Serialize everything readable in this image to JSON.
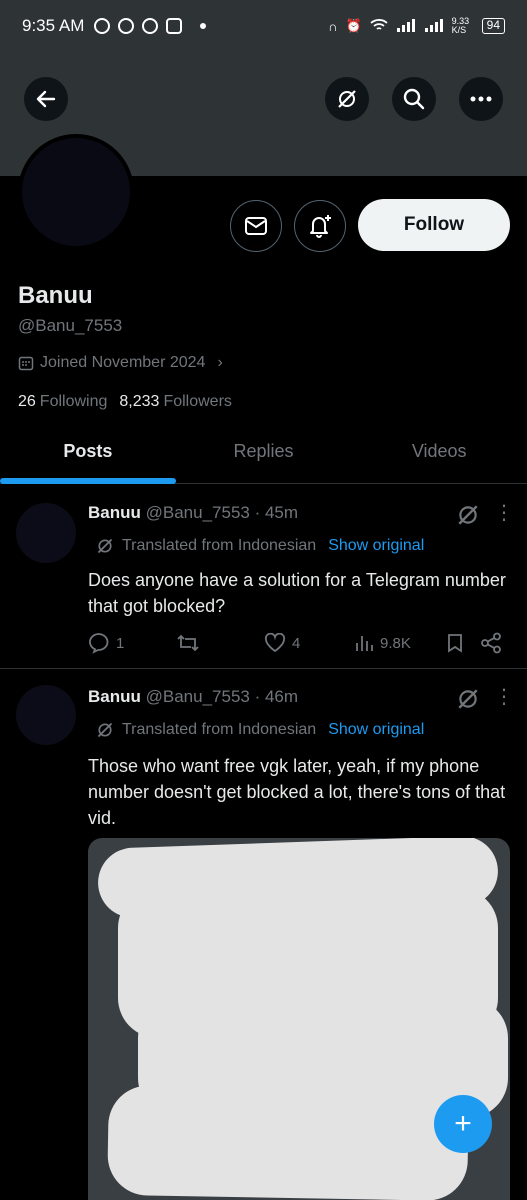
{
  "status_bar": {
    "time": "9:35 AM",
    "net_speed": "9.33 K/S",
    "battery": "94"
  },
  "profile": {
    "name": "Banuu",
    "handle": "@Banu_7553",
    "joined": "Joined November 2024",
    "following_count": "26",
    "following_label": "Following",
    "followers_count": "8,233",
    "followers_label": "Followers",
    "follow_label": "Follow"
  },
  "tabs": [
    {
      "label": "Posts",
      "active": true
    },
    {
      "label": "Replies"
    },
    {
      "label": "Videos"
    }
  ],
  "posts": [
    {
      "author": "Banuu",
      "meta": "@Banu_7553 · 45m",
      "translated": "Translated from Indonesian",
      "show_original": "Show original",
      "text": "Does anyone have a solution for a Telegram number that got blocked?",
      "replies": "1",
      "likes": "4",
      "views": "9.8K"
    },
    {
      "author": "Banuu",
      "meta": "@Banu_7553 · 46m",
      "translated": "Translated from Indonesian",
      "show_original": "Show original",
      "text": "Those who want free vgk later, yeah, if my phone number doesn't get blocked a lot, there's tons of that vid."
    }
  ],
  "colors": {
    "accent": "#1d9bf0",
    "banner": "#2e3336",
    "muted": "#71767b"
  }
}
